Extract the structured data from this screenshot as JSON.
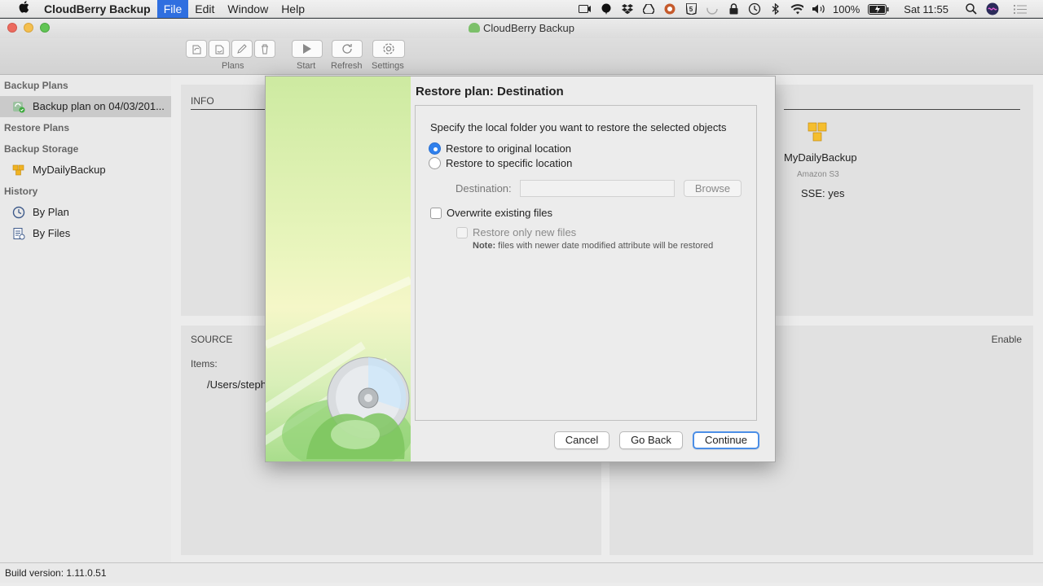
{
  "menubar": {
    "app_name": "CloudBerry Backup",
    "items": [
      "File",
      "Edit",
      "Window",
      "Help"
    ],
    "active_item": "File",
    "battery": "100%",
    "clock": "Sat 11:55"
  },
  "window": {
    "title": "CloudBerry Backup"
  },
  "toolbar": {
    "plans_label": "Plans",
    "start_label": "Start",
    "refresh_label": "Refresh",
    "settings_label": "Settings"
  },
  "sidebar": {
    "backup_plans_header": "Backup Plans",
    "backup_plan_item": "Backup plan on 04/03/201...",
    "restore_plans_header": "Restore Plans",
    "backup_storage_header": "Backup Storage",
    "storage_item": "MyDailyBackup",
    "history_header": "History",
    "by_plan": "By Plan",
    "by_files": "By Files"
  },
  "main": {
    "info_title": "INFO",
    "source_title": "SOURCE",
    "items_label": "Items:",
    "source_path": "/Users/steph",
    "storage_name": "MyDailyBackup",
    "storage_type": "Amazon S3",
    "sse_label": "SSE:",
    "sse_value": "yes",
    "enable_label": "Enable"
  },
  "dialog": {
    "title": "Restore plan: Destination",
    "prompt": "Specify the local folder you want to restore the selected objects",
    "radio_original": "Restore to original location",
    "radio_specific": "Restore to specific location",
    "selected_option": "original",
    "destination_label": "Destination:",
    "destination_value": "",
    "browse_button": "Browse",
    "overwrite_label": "Overwrite existing files",
    "overwrite_checked": false,
    "restore_new_label": "Restore only new files",
    "note_prefix": "Note:",
    "note_text": " files with newer date modified attribute will be restored",
    "cancel_button": "Cancel",
    "go_back_button": "Go Back",
    "continue_button": "Continue"
  },
  "statusbar": {
    "build_version": "Build version: 1.11.0.51"
  },
  "colors": {
    "accent": "#2f80ed",
    "menu_highlight": "#2f6fe0"
  }
}
